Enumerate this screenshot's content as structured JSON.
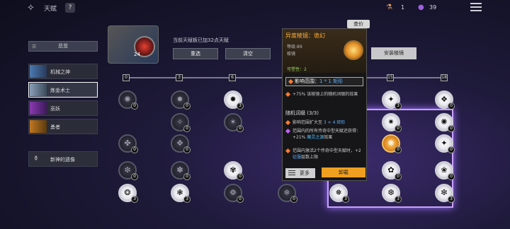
{
  "header": {
    "title": "天赋",
    "help": "?",
    "currency1": {
      "value": "1"
    },
    "currency2": {
      "value": "39"
    }
  },
  "sidebar": {
    "overview": "总览",
    "categories": [
      {
        "label": "机械之神",
        "color": "#4a7ab0"
      },
      {
        "label": "炼金术士",
        "color": "#8aa0b8",
        "active": true
      },
      {
        "label": "巫妖",
        "color": "#8a3ab0"
      },
      {
        "label": "勇者",
        "color": "#c07820"
      }
    ],
    "shrine": "新神的遗像"
  },
  "profile": {
    "level": "24",
    "info": "当前天赋板已加32点天赋",
    "reset": "重选",
    "clear": "清空"
  },
  "tooltip": {
    "view": "查价",
    "title": "异度棱镜：诡幻",
    "level": "等级:89",
    "type": "棱镜",
    "plasticity": "可塑性：2",
    "range_label": "影响范围：",
    "range_value": "1 * 1 矩形",
    "effect": "+75% 该棱镜上的随机词缀的效果",
    "random_title": "随机词缀 (3/3)",
    "entries": [
      {
        "pre": "影响范围扩大至 ",
        "hl": "3 × 4 矩形",
        "post": ""
      },
      {
        "pre": "范围内的所有传奇中型天赋还获得：+21% ",
        "hl": "魔灵之源",
        "post": "效果"
      },
      {
        "pre": "范围内激活2个传奇中型天赋时，+2 ",
        "hl": "征服",
        "post": "层数上限"
      }
    ],
    "more": "更多",
    "unload": "卸载",
    "install": "安装棱镜"
  },
  "track": {
    "ticks": [
      "0",
      "3",
      "6",
      "15",
      "18"
    ]
  },
  "nodes": [
    {
      "glyph": "✺",
      "cnt": "0"
    },
    {
      "glyph": "✸",
      "cnt": "0"
    },
    {
      "glyph": "✹",
      "cnt": "3",
      "lit": true
    },
    {
      "glyph": "✦",
      "cnt": "3",
      "lit": true
    },
    {
      "glyph": "❖",
      "cnt": "0",
      "lit": true
    },
    {
      "glyph": "✧",
      "cnt": "0"
    },
    {
      "glyph": "✶",
      "cnt": "0"
    },
    {
      "glyph": "✷",
      "cnt": "0",
      "lit": true
    },
    {
      "glyph": "✺",
      "cnt": "0",
      "lit": true
    },
    {
      "glyph": "✤",
      "cnt": "0"
    },
    {
      "glyph": "✥",
      "cnt": "0"
    },
    {
      "glyph": "❋",
      "cnt": "0",
      "gold": true
    },
    {
      "glyph": "✦",
      "cnt": "0",
      "lit": true
    },
    {
      "glyph": "✼",
      "cnt": "0"
    },
    {
      "glyph": "✽",
      "cnt": "0"
    },
    {
      "glyph": "✾",
      "cnt": "0",
      "lit": true
    },
    {
      "glyph": "✿",
      "cnt": "0",
      "lit": true
    },
    {
      "glyph": "❀",
      "cnt": "0",
      "lit": true
    },
    {
      "glyph": "❂",
      "cnt": "3",
      "lit": true
    },
    {
      "glyph": "❃",
      "cnt": "3",
      "lit": true
    },
    {
      "glyph": "❁",
      "cnt": "0"
    },
    {
      "glyph": "❄",
      "cnt": "0"
    },
    {
      "glyph": "❅",
      "cnt": "3",
      "lit": true
    },
    {
      "glyph": "❆",
      "cnt": "3",
      "lit": true
    },
    {
      "glyph": "❇",
      "cnt": "3",
      "lit": true
    }
  ]
}
